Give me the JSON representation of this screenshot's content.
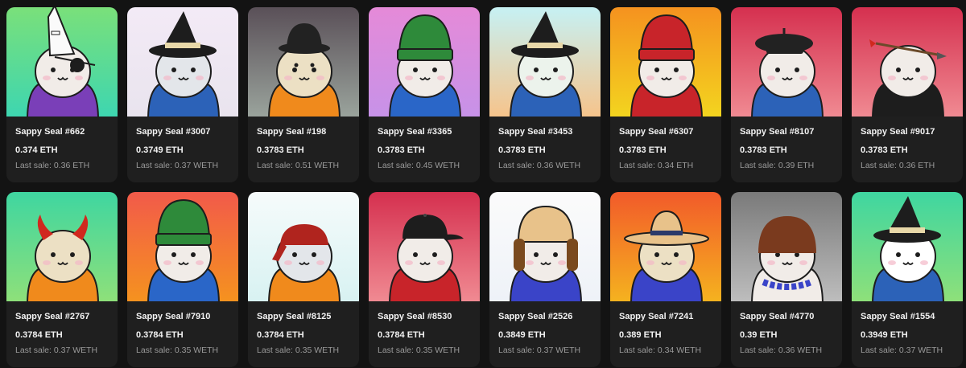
{
  "items": [
    {
      "name": "Sappy Seal #662",
      "price": "0.374 ETH",
      "last_sale": "Last sale: 0.36 ETH",
      "bg": [
        "#7ae07a",
        "#3ed6b0"
      ],
      "hat": "party",
      "shirt": "#7a3fb8",
      "body": "#f1ece8",
      "accent": "#ffffff"
    },
    {
      "name": "Sappy Seal #3007",
      "price": "0.3749 ETH",
      "last_sale": "Last sale: 0.37 WETH",
      "bg": [
        "#f3eaf6",
        "#e9e4ee"
      ],
      "hat": "witch",
      "shirt": "#2c62b8",
      "body": "#e3e6ea",
      "accent": "#e8d8a8"
    },
    {
      "name": "Sappy Seal #198",
      "price": "0.3783 ETH",
      "last_sale": "Last sale: 0.51 WETH",
      "bg": [
        "#5a5058",
        "#9aa39c"
      ],
      "hat": "bucket",
      "shirt": "#f08a1c",
      "body": "#ece0c4",
      "accent": "#222222"
    },
    {
      "name": "Sappy Seal #3365",
      "price": "0.3783 ETH",
      "last_sale": "Last sale: 0.45 WETH",
      "bg": [
        "#e58ad8",
        "#c792e8"
      ],
      "hat": "beanie",
      "shirt": "#2a66c8",
      "body": "#f1ece8",
      "accent": "#2e8a3a"
    },
    {
      "name": "Sappy Seal #3453",
      "price": "0.3783 ETH",
      "last_sale": "Last sale: 0.36 WETH",
      "bg": [
        "#c6f1f4",
        "#f6c48c"
      ],
      "hat": "witch",
      "shirt": "#2c62b8",
      "body": "#ecf3ec",
      "accent": "#e8d8a8"
    },
    {
      "name": "Sappy Seal #6307",
      "price": "0.3783 ETH",
      "last_sale": "Last sale: 0.34 ETH",
      "bg": [
        "#f5921f",
        "#f3d41f"
      ],
      "hat": "beanie",
      "shirt": "#c8242a",
      "body": "#f1ece8",
      "accent": "#c8242a"
    },
    {
      "name": "Sappy Seal #8107",
      "price": "0.3783 ETH",
      "last_sale": "Last sale: 0.39 ETH",
      "bg": [
        "#d5304f",
        "#f08a92"
      ],
      "hat": "beret",
      "shirt": "#2c62b8",
      "body": "#f1ece8",
      "accent": "#222222"
    },
    {
      "name": "Sappy Seal #9017",
      "price": "0.3783 ETH",
      "last_sale": "Last sale: 0.36 ETH",
      "bg": [
        "#d5304f",
        "#f08a92"
      ],
      "hat": "arrow",
      "shirt": "#1d1d1d",
      "body": "#f1ece8",
      "accent": "#8a5a2a"
    },
    {
      "name": "Sappy Seal #2767",
      "price": "0.3784 ETH",
      "last_sale": "Last sale: 0.37 WETH",
      "bg": [
        "#3fd6a0",
        "#8ee07a"
      ],
      "hat": "horns",
      "shirt": "#f08a1c",
      "body": "#ece0c4",
      "accent": "#d0281e"
    },
    {
      "name": "Sappy Seal #7910",
      "price": "0.3784 ETH",
      "last_sale": "Last sale: 0.35 WETH",
      "bg": [
        "#f25a4a",
        "#f5921f"
      ],
      "hat": "beanie",
      "shirt": "#2a66c8",
      "body": "#f1ece8",
      "accent": "#2e8a3a"
    },
    {
      "name": "Sappy Seal #8125",
      "price": "0.3784 ETH",
      "last_sale": "Last sale: 0.35 WETH",
      "bg": [
        "#f6fbfb",
        "#d8f2f2"
      ],
      "hat": "bandana",
      "shirt": "#f08a1c",
      "body": "#e3e6ea",
      "accent": "#b0241e"
    },
    {
      "name": "Sappy Seal #8530",
      "price": "0.3784 ETH",
      "last_sale": "Last sale: 0.35 WETH",
      "bg": [
        "#d5304f",
        "#f08a92"
      ],
      "hat": "cap",
      "shirt": "#c8242a",
      "body": "#f1ece8",
      "accent": "#1d1d1d"
    },
    {
      "name": "Sappy Seal #2526",
      "price": "0.3849 ETH",
      "last_sale": "Last sale: 0.37 WETH",
      "bg": [
        "#fbfbfb",
        "#eef2f8"
      ],
      "hat": "ushanka",
      "shirt": "#3a44c8",
      "body": "#f1ece8",
      "accent": "#e8c28a"
    },
    {
      "name": "Sappy Seal #7241",
      "price": "0.389 ETH",
      "last_sale": "Last sale: 0.34 WETH",
      "bg": [
        "#f25a2a",
        "#f5b21f"
      ],
      "hat": "cowboy",
      "shirt": "#3a44c8",
      "body": "#ece0c4",
      "accent": "#e8c28a"
    },
    {
      "name": "Sappy Seal #4770",
      "price": "0.39 ETH",
      "last_sale": "Last sale: 0.36 WETH",
      "bg": [
        "#7a7a7a",
        "#bdbdbd"
      ],
      "hat": "bowl",
      "shirt": "#f1ece8",
      "body": "#f1ece8",
      "accent": "#7a3a1e"
    },
    {
      "name": "Sappy Seal #1554",
      "price": "0.3949 ETH",
      "last_sale": "Last sale: 0.37 WETH",
      "bg": [
        "#3fd6a0",
        "#8ee07a"
      ],
      "hat": "witch",
      "shirt": "#2c62b8",
      "body": "#ffffff",
      "accent": "#e8d8a8"
    }
  ]
}
